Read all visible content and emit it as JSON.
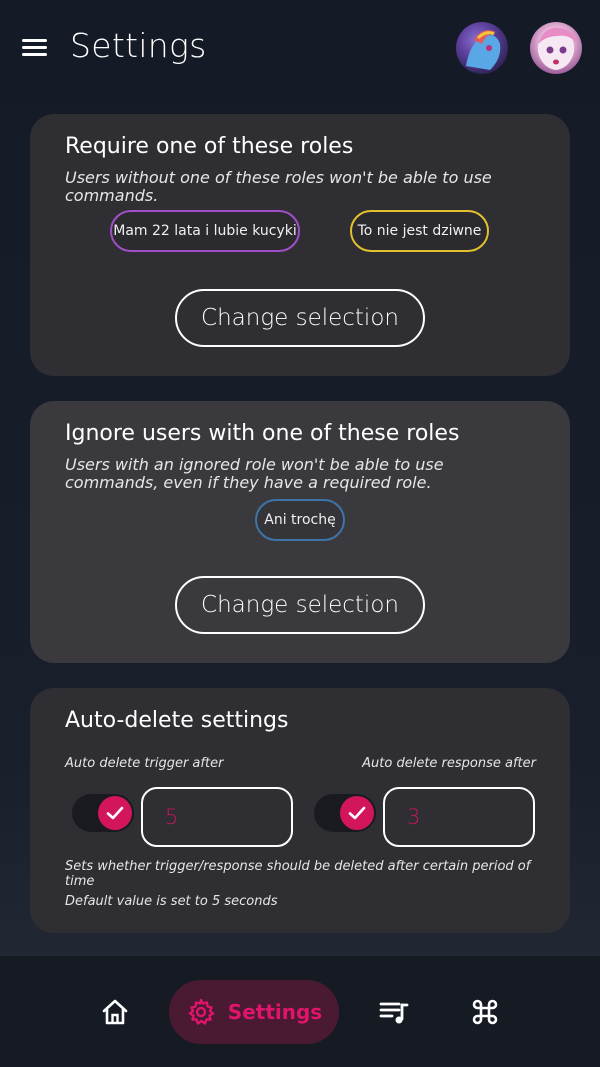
{
  "header": {
    "title": "Settings",
    "avatars": [
      "avatar",
      "avatar"
    ]
  },
  "required_roles": {
    "title": "Require one of these roles",
    "description": "Users without one of these roles won't be able to use commands.",
    "roles": [
      {
        "name": "Mam 22 lata i lubie kucyki",
        "color": "#a14fc8"
      },
      {
        "name": "To nie jest dziwne",
        "color": "#e3c12d"
      }
    ],
    "button_label": "Change selection"
  },
  "ignored_roles": {
    "title": "Ignore users with one of these roles",
    "description": "Users with an ignored role won't be able to use commands, even if they have a required role.",
    "roles": [
      {
        "name": "Ani trochę",
        "color": "#3f74a8"
      }
    ],
    "button_label": "Change selection"
  },
  "auto_delete": {
    "title": "Auto-delete settings",
    "trigger_label": "Auto delete trigger after",
    "response_label": "Auto delete response after",
    "trigger_enabled": true,
    "response_enabled": true,
    "trigger_value": "5",
    "response_value": "3",
    "note_1": "Sets whether trigger/response should be deleted after certain period of time",
    "note_2": "Default value is set to 5 seconds"
  },
  "bottom_nav": {
    "active": "Settings",
    "items": [
      {
        "icon": "home-icon"
      },
      {
        "icon": "gear-icon",
        "label": "Settings"
      },
      {
        "icon": "playlist-icon"
      },
      {
        "icon": "command-icon"
      }
    ]
  },
  "colors": {
    "accent": "#d3165c",
    "card": "#2f2f33",
    "background": "#161b25"
  }
}
